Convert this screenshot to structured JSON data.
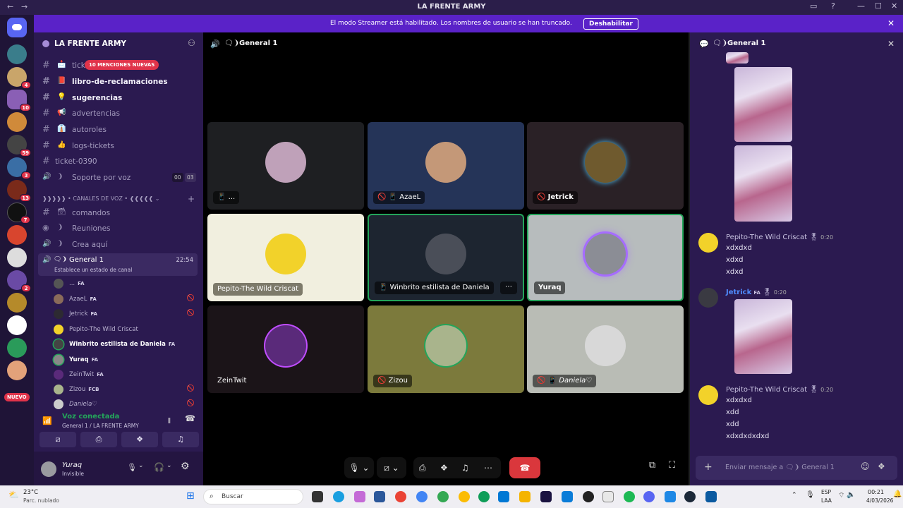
{
  "window": {
    "title": "LA FRENTE ARMY"
  },
  "banner": {
    "text": "El modo Streamer está habilitado. Los nombres de usuario se han truncado.",
    "button": "Deshabilitar"
  },
  "rail": {
    "badges": [
      "4",
      "10",
      "59",
      "3",
      "13",
      "7",
      "2"
    ],
    "new_label": "NUEVO"
  },
  "sidebar": {
    "guild_name": "LA FRENTE ARMY",
    "mentions_pill": "10 MENCIONES NUEVAS",
    "channels": [
      {
        "prefix": "#",
        "emoji": "📩",
        "name": "tick"
      },
      {
        "prefix": "#",
        "emoji": "📕",
        "name": "libro-de-reclamaciones"
      },
      {
        "prefix": "#",
        "emoji": "💡",
        "name": "sugerencias"
      },
      {
        "prefix": "#",
        "emoji": "📢",
        "name": "advertencias"
      },
      {
        "prefix": "#",
        "emoji": "👔",
        "name": "autoroles"
      },
      {
        "prefix": "#",
        "emoji": "👍",
        "name": "logs-tickets"
      },
      {
        "prefix": "🔊",
        "emoji": "❩",
        "name": "Soporte por voz",
        "counts": [
          "00",
          "03"
        ]
      },
      {
        "prefix": "#",
        "emoji": "",
        "name": "ticket-0390"
      }
    ],
    "voice_category": "❱❱❱❱❱ • CANALES DE VOZ • ❰❰❰❰❰",
    "voice_channels": [
      {
        "prefix": "#",
        "emoji": "🗃",
        "name": "comandos"
      },
      {
        "prefix": "◉",
        "emoji": "❩",
        "name": "Reuniones"
      },
      {
        "prefix": "🔊",
        "emoji": "❩",
        "name": "Crea aquí"
      }
    ],
    "active_channel": {
      "name": "General 1",
      "time": "22:54",
      "status": "Establece un estado de canal"
    },
    "voice_users": [
      {
        "name": "...",
        "tag": "FA"
      },
      {
        "name": "AzaeL",
        "tag": "FA"
      },
      {
        "name": "Jetrick",
        "tag": "FA"
      },
      {
        "name": "Pepito-The Wild Criscat",
        "tag": ""
      },
      {
        "name": "Winbrito estilista de Daniela",
        "tag": "FA"
      },
      {
        "name": "Yuraq",
        "tag": "FA"
      },
      {
        "name": "ZeinTwit",
        "tag": "FA"
      },
      {
        "name": "Zizou",
        "tag": "FCB"
      },
      {
        "name": "Daniela♡",
        "tag": ""
      }
    ],
    "voice_connected": {
      "title": "Voz conectada",
      "subtitle": "General 1 / LA FRENTE ARMY"
    },
    "user": {
      "name": "Yuraq",
      "status": "Invisible"
    }
  },
  "stage": {
    "header": "General 1",
    "tiles": [
      {
        "name": "...",
        "bg": "#1e1f22",
        "avatar": "#bfa1b9"
      },
      {
        "name": "AzaeL",
        "bg": "#253458",
        "avatar": "#c49878"
      },
      {
        "name": "Jetrick",
        "bg": "#2a2126",
        "avatar": "#6f5a2e"
      },
      {
        "name": "Pepito-The Wild Criscat",
        "bg": "#f1efdf",
        "avatar": "#f2d22a"
      },
      {
        "name": "Winbrito estilista de Daniela",
        "bg": "#1d2530",
        "avatar": "#4a4e58"
      },
      {
        "name": "Yuraq",
        "bg": "#b7bcbd",
        "avatar": "#8b8d95"
      },
      {
        "name": "ZeinTwit",
        "bg": "#1b1418",
        "avatar": "#5a2a7a"
      },
      {
        "name": "Zizou",
        "bg": "#7c7a3c",
        "avatar": "#a9b48c"
      },
      {
        "name": "Daniela♡",
        "bg": "#b9bcb5",
        "avatar": "#d8d8d8"
      }
    ]
  },
  "chat": {
    "header": "General 1",
    "messages": [
      {
        "author": "Pepito-The Wild Criscat",
        "time": "0:20",
        "lines": [
          "xdxdxd",
          "xdxd",
          "xdxd"
        ]
      },
      {
        "author": "Jetrick",
        "tag": "FA",
        "time": "0:20",
        "lines": []
      },
      {
        "author": "Pepito-The Wild Criscat",
        "time": "0:20",
        "lines": [
          "xdxdxd",
          "xdd",
          "xdd",
          "xdxdxdxdxd"
        ]
      }
    ],
    "input_placeholder": "Enviar mensaje a 🗨❩ General 1"
  },
  "taskbar": {
    "weather_temp": "23°C",
    "weather_desc": "Parc. nublado",
    "search": "Buscar",
    "lang1": "ESP",
    "lang2": "LAA",
    "time": "00:21",
    "date": "4/03/2026"
  },
  "colors": {
    "accent": "#5a22c8",
    "danger": "#da373c"
  }
}
